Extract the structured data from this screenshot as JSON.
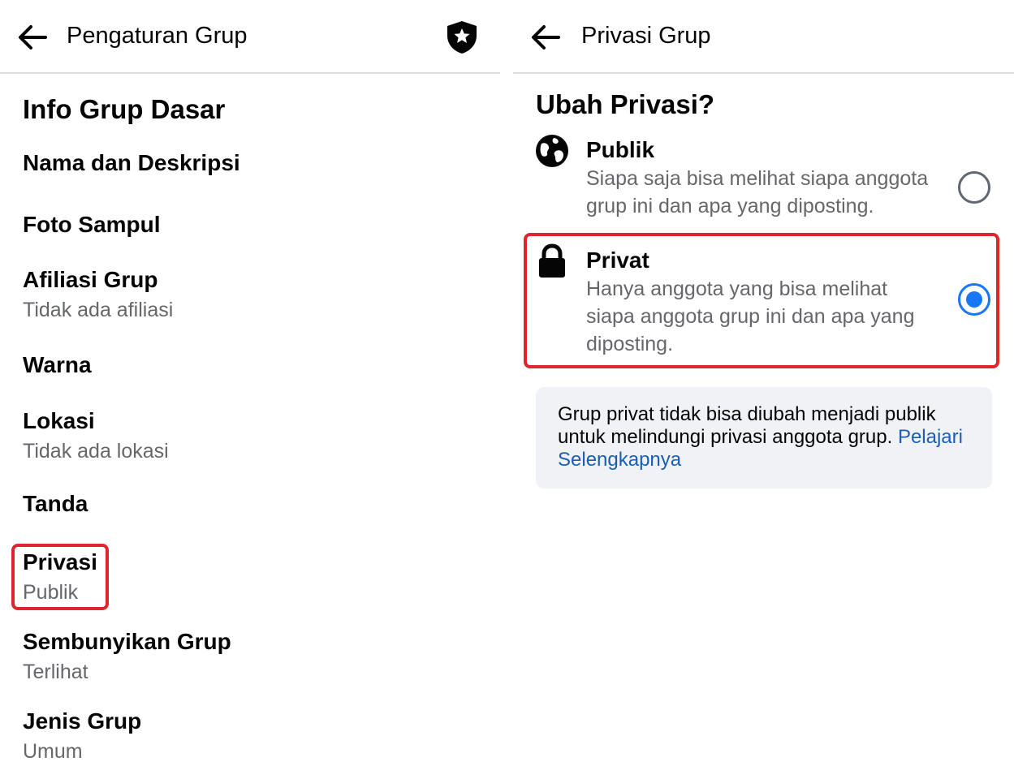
{
  "left": {
    "header": {
      "title": "Pengaturan Grup",
      "back_icon": "arrow-left-icon",
      "admin_icon": "shield-star-icon"
    },
    "section_title": "Info Grup Dasar",
    "items": [
      {
        "title": "Nama dan Deskripsi",
        "subtitle": ""
      },
      {
        "title": "Foto Sampul",
        "subtitle": ""
      },
      {
        "title": "Afiliasi Grup",
        "subtitle": "Tidak ada afiliasi"
      },
      {
        "title": "Warna",
        "subtitle": ""
      },
      {
        "title": "Lokasi",
        "subtitle": "Tidak ada lokasi"
      },
      {
        "title": "Tanda",
        "subtitle": ""
      },
      {
        "title": "Privasi",
        "subtitle": "Publik",
        "highlighted": true
      },
      {
        "title": "Sembunyikan Grup",
        "subtitle": "Terlihat"
      },
      {
        "title": "Jenis Grup",
        "subtitle": "Umum"
      }
    ]
  },
  "right": {
    "header": {
      "title": "Privasi Grup",
      "back_icon": "arrow-left-icon"
    },
    "question": "Ubah Privasi?",
    "options": [
      {
        "icon": "globe-icon",
        "title": "Publik",
        "lines": [
          "Siapa saja bisa melihat siapa anggota",
          "grup ini dan apa yang diposting."
        ],
        "selected": false
      },
      {
        "icon": "lock-icon",
        "title": "Privat",
        "lines": [
          "Hanya anggota yang bisa melihat",
          "siapa anggota grup ini dan apa yang",
          "diposting."
        ],
        "selected": true,
        "highlighted": true
      }
    ],
    "notice": {
      "line1": "Grup privat tidak bisa diubah menjadi publik",
      "line2": "untuk melindungi privasi anggota grup.",
      "link_part1": "Pelajari",
      "link_part2": "Selengkapnya"
    }
  },
  "colors": {
    "highlight": "#e0262c",
    "accent": "#1877f2",
    "link": "#1a5fb4",
    "notice_bg": "#f0f2f5",
    "secondary_text": "#65676b"
  }
}
